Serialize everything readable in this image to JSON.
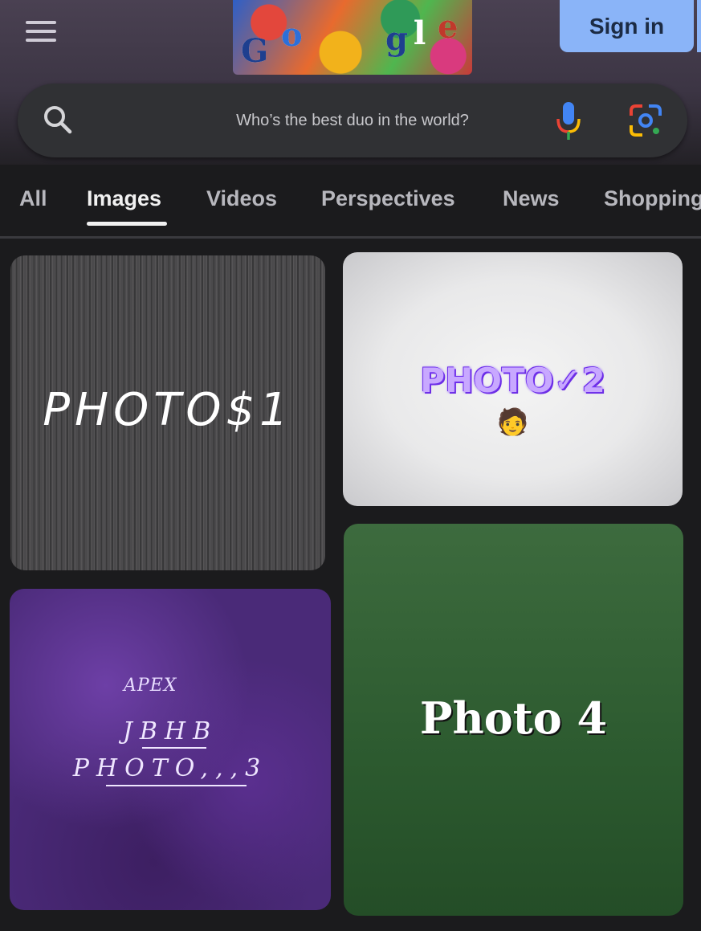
{
  "header": {
    "menu_icon": "hamburger-menu-icon",
    "doodle_letters": [
      "G",
      "o",
      "g",
      "l",
      "e"
    ],
    "sign_in_label": "Sign in"
  },
  "search": {
    "query": "Who’s the best duo in the world?",
    "icons": [
      "search-icon",
      "microphone-icon",
      "google-lens-icon"
    ]
  },
  "tabs": [
    {
      "label": "All"
    },
    {
      "label": "Images"
    },
    {
      "label": "Videos"
    },
    {
      "label": "Perspectives"
    },
    {
      "label": "News"
    },
    {
      "label": "Shopping"
    }
  ],
  "active_tab": "Images",
  "results": [
    {
      "caption": "PHOTO$1"
    },
    {
      "caption": "PHOTO✓2",
      "emoji": "🧑"
    },
    {
      "brand": "APEX",
      "line1": "JBHB",
      "line2": "PHOTO,,,3"
    },
    {
      "caption": "Photo 4"
    }
  ],
  "colors": {
    "accent_blue": "#8ab4f8",
    "background": "#1b1b1d",
    "search_bar": "#303134"
  }
}
